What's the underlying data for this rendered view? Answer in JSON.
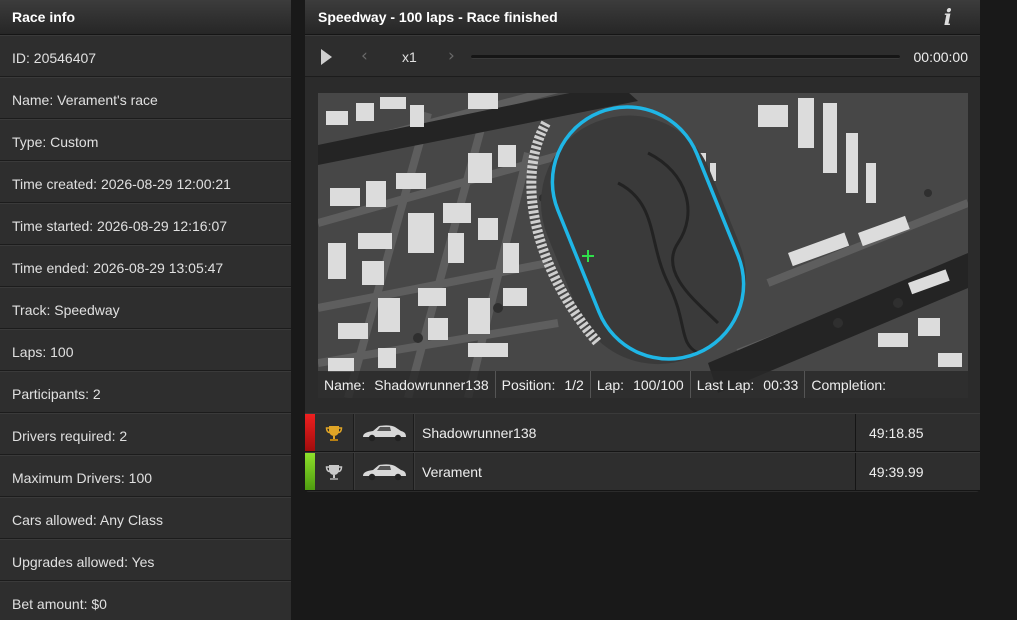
{
  "race_info": {
    "title": "Race info",
    "rows": [
      "ID: 20546407",
      "Name: Verament's race",
      "Type: Custom",
      "Time created: 2026-08-29 12:00:21",
      "Time started: 2026-08-29 12:16:07",
      "Time ended: 2026-08-29 13:05:47",
      "Track: Speedway",
      "Laps: 100",
      "Participants: 2",
      "Drivers required: 2",
      "Maximum Drivers: 100",
      "Cars allowed: Any Class",
      "Upgrades allowed: Yes",
      "Bet amount: $0"
    ]
  },
  "race": {
    "title": "Speedway - 100 laps - Race finished",
    "info_icon": "info-icon"
  },
  "controls": {
    "play_icon": "play-icon",
    "prev_icon": "chevron-left-icon",
    "speed": "x1",
    "next_icon": "chevron-right-icon",
    "time": "00:00:00"
  },
  "status": {
    "name_label": "Name:",
    "name_value": "Shadowrunner138",
    "position_label": "Position:",
    "position_value": "1/2",
    "lap_label": "Lap:",
    "lap_value": "100/100",
    "last_lap_label": "Last Lap:",
    "last_lap_value": "00:33",
    "completion_label": "Completion:",
    "completion_value": ""
  },
  "results": [
    {
      "name": "Shadowrunner138",
      "time": "49:18.85",
      "trophy": "gold-trophy-icon",
      "status_color": "#e41b1b"
    },
    {
      "name": "Verament",
      "time": "49:39.99",
      "trophy": "silver-trophy-icon",
      "status_color": "#7fd21e"
    }
  ],
  "colors": {
    "track_line": "#1fb6e6",
    "marker": "#2fe04a"
  }
}
